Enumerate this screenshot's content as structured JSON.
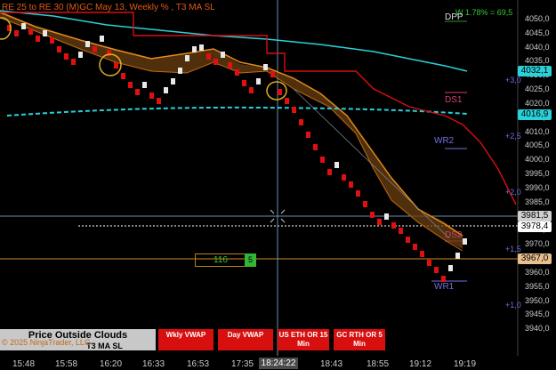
{
  "chart_title": "RE 25 to RE 30 (M)GC May 13, Weekly % , T3 MA SL",
  "dpp_note": "W 1.78% = 69,5",
  "levels": {
    "dpp": "DPP",
    "ds1": "DS1",
    "wr2": "WR2",
    "ds2": "DS2",
    "wr1": "WR1"
  },
  "price_labels": {
    "p1": "4032,1",
    "p2": "4016,9",
    "p3": "3981,5",
    "p4": "3978,4",
    "p5": "3967,0"
  },
  "y_ticks": [
    "4050,0",
    "4045,0",
    "4040,0",
    "4035,0",
    "4030,0",
    "4025,0",
    "4020,0",
    "4015,0",
    "4010,0",
    "4005,0",
    "4000,0",
    "3995,0",
    "3990,0",
    "3985,0",
    "3980,0",
    "3975,0",
    "3970,0",
    "3965,0",
    "3960,0",
    "3955,0",
    "3950,0",
    "3945,0",
    "3940,0"
  ],
  "sd_labels": [
    "+3,0",
    "+2,5",
    "+2,0",
    "+1,5",
    "+1,0"
  ],
  "x_ticks": [
    "15:48",
    "15:58",
    "16:20",
    "16:33",
    "16:53",
    "17:35",
    "18:43",
    "18:55",
    "19:12",
    "19:19"
  ],
  "x_cursor": "18:24:22",
  "order": {
    "qty": "116",
    "marker": "5"
  },
  "status": {
    "label": "Price Outside Clouds",
    "sub": "T3 MA SL"
  },
  "copyright": "© 2025 NinjaTrader, LLC",
  "buttons": {
    "wkly": "Wkly VWAP",
    "day": "Day VWAP",
    "us": "US ETH OR 15 Min",
    "gc": "GC RTH OR 5 Min"
  },
  "colors": {
    "up": "#e8e8e8",
    "down": "#e01010",
    "cloud": "#6b3f12",
    "cyan": "#2ad1d9",
    "accent": "#e05a12"
  },
  "icons": [
    "crosshair-icon"
  ]
}
